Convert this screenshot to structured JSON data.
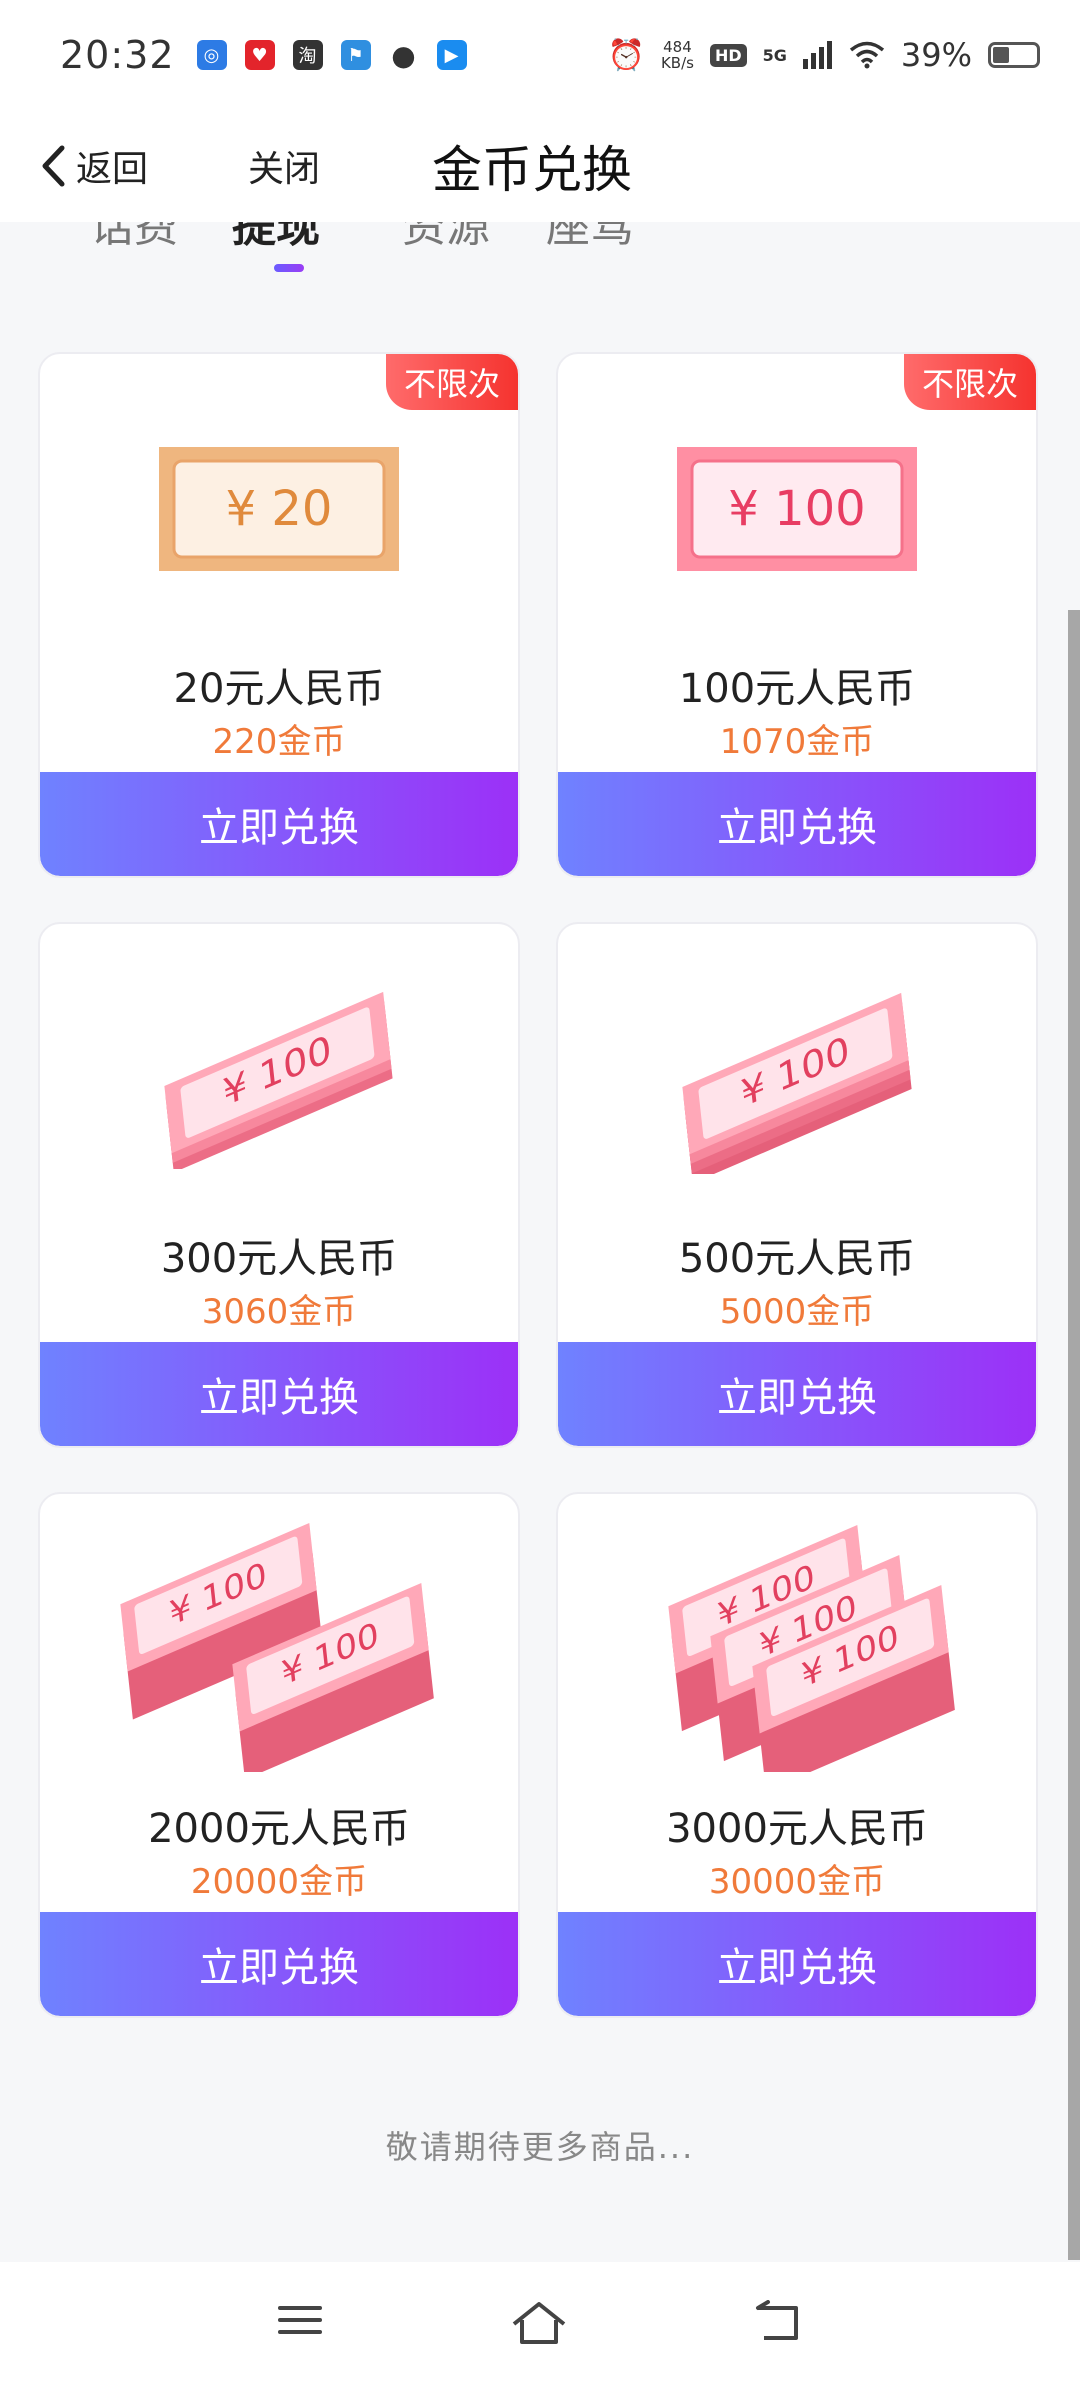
{
  "status_bar": {
    "time": "20:32",
    "network_speed_value": "484",
    "network_speed_unit": "KB/s",
    "hd_label": "HD",
    "signal_label": "5G",
    "battery_percent": "39%",
    "battery_level": 0.39
  },
  "header": {
    "back_label": "返回",
    "close_label": "关闭",
    "title": "金币兑换"
  },
  "tabs": [
    {
      "label": "话费"
    },
    {
      "label": "提现"
    },
    {
      "label": "资源"
    },
    {
      "label": "座驾"
    }
  ],
  "active_tab": "提现",
  "products": [
    {
      "name": "20元人民币",
      "price": "220金币",
      "button": "立即兑换",
      "badge": "不限次",
      "image": "ticket-20",
      "ticket_text": "¥ 20"
    },
    {
      "name": "100元人民币",
      "price": "1070金币",
      "button": "立即兑换",
      "badge": "不限次",
      "image": "ticket-100",
      "ticket_text": "¥ 100"
    },
    {
      "name": "300元人民币",
      "price": "3060金币",
      "button": "立即兑换",
      "image": "small-stack-100",
      "ticket_text": "¥ 100"
    },
    {
      "name": "500元人民币",
      "price": "5000金币",
      "button": "立即兑换",
      "image": "medium-stack-100",
      "ticket_text": "¥ 100"
    },
    {
      "name": "2000元人民币",
      "price": "20000金币",
      "button": "立即兑换",
      "image": "double-stack-100",
      "ticket_text": "¥ 100"
    },
    {
      "name": "3000元人民币",
      "price": "30000金币",
      "button": "立即兑换",
      "image": "triple-stack-100",
      "ticket_text": "¥ 100"
    }
  ],
  "footer_text": "敬请期待更多商品...",
  "colors": {
    "accent_start": "#6f82ff",
    "accent_end": "#9c30f7",
    "price": "#f07a3a",
    "badge": "#f5332f"
  }
}
